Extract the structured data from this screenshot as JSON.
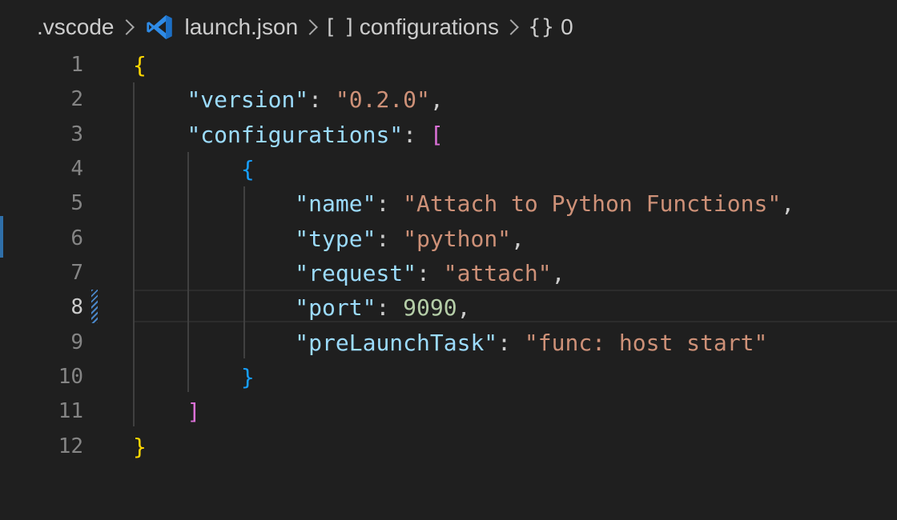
{
  "breadcrumb": {
    "folder": ".vscode",
    "file_icon": "vscode-logo-icon",
    "file": "launch.json",
    "array_symbol": "[ ]",
    "array_key": "configurations",
    "object_symbol": "{}",
    "object_index": "0"
  },
  "editor": {
    "active_line": 8,
    "line_numbers": [
      "1",
      "2",
      "3",
      "4",
      "5",
      "6",
      "7",
      "8",
      "9",
      "10",
      "11",
      "12"
    ],
    "indent": "    ",
    "lines": [
      [
        {
          "t": "{",
          "c": "b1"
        }
      ],
      [
        {
          "t": "\"version\"",
          "c": "key"
        },
        {
          "t": ": ",
          "c": "punc"
        },
        {
          "t": "\"0.2.0\"",
          "c": "str"
        },
        {
          "t": ",",
          "c": "punc"
        }
      ],
      [
        {
          "t": "\"configurations\"",
          "c": "key"
        },
        {
          "t": ": ",
          "c": "punc"
        },
        {
          "t": "[",
          "c": "b2"
        }
      ],
      [
        {
          "t": "{",
          "c": "b3"
        }
      ],
      [
        {
          "t": "\"name\"",
          "c": "key"
        },
        {
          "t": ": ",
          "c": "punc"
        },
        {
          "t": "\"Attach to Python Functions\"",
          "c": "str"
        },
        {
          "t": ",",
          "c": "punc"
        }
      ],
      [
        {
          "t": "\"type\"",
          "c": "key"
        },
        {
          "t": ": ",
          "c": "punc"
        },
        {
          "t": "\"python\"",
          "c": "str"
        },
        {
          "t": ",",
          "c": "punc"
        }
      ],
      [
        {
          "t": "\"request\"",
          "c": "key"
        },
        {
          "t": ": ",
          "c": "punc"
        },
        {
          "t": "\"attach\"",
          "c": "str"
        },
        {
          "t": ",",
          "c": "punc"
        }
      ],
      [
        {
          "t": "\"port\"",
          "c": "key"
        },
        {
          "t": ": ",
          "c": "punc"
        },
        {
          "t": "9090",
          "c": "num"
        },
        {
          "t": ",",
          "c": "punc"
        }
      ],
      [
        {
          "t": "\"preLaunchTask\"",
          "c": "key"
        },
        {
          "t": ": ",
          "c": "punc"
        },
        {
          "t": "\"func: host start\"",
          "c": "str"
        }
      ],
      [
        {
          "t": "}",
          "c": "b3"
        }
      ],
      [
        {
          "t": "]",
          "c": "b2"
        }
      ],
      [
        {
          "t": "}",
          "c": "b1"
        }
      ]
    ],
    "indent_levels": [
      0,
      1,
      1,
      2,
      3,
      3,
      3,
      3,
      3,
      2,
      1,
      0
    ]
  },
  "colors": {
    "background": "#1f1f1f",
    "key": "#9cdcfe",
    "string": "#ce9178",
    "number": "#b5cea8",
    "bracket_level_1": "#ffd700",
    "bracket_level_2": "#da70d6",
    "bracket_level_3": "#179fff"
  }
}
